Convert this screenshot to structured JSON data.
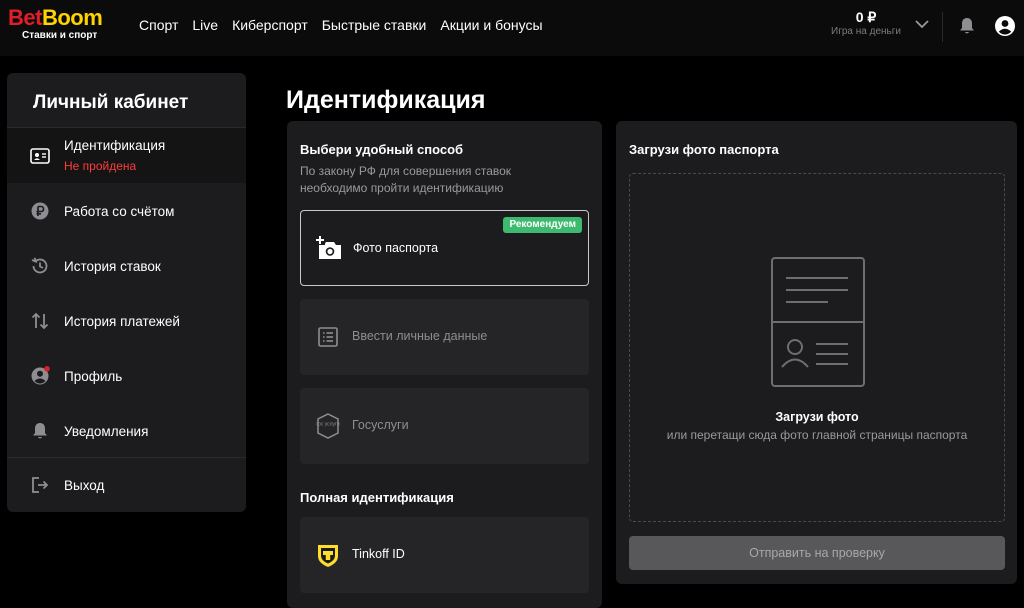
{
  "header": {
    "logo": {
      "part1": "Bet",
      "part2": "Boom",
      "tagline": "Ставки и спорт"
    },
    "nav": [
      "Спорт",
      "Live",
      "Киберспорт",
      "Быстрые ставки",
      "Акции и бонусы"
    ],
    "balance": {
      "amount": "0 ₽",
      "label": "Игра на деньги"
    },
    "icons": [
      "chevron-down-icon",
      "bell-icon",
      "user-icon"
    ]
  },
  "sidebar": {
    "title": "Личный кабинет",
    "items": [
      {
        "label": "Идентификация",
        "status": "Не пройдена",
        "icon": "id-card-icon"
      },
      {
        "label": "Работа со счётом",
        "icon": "ruble-icon"
      },
      {
        "label": "История ставок",
        "icon": "history-icon"
      },
      {
        "label": "История платежей",
        "icon": "transfer-arrows-icon"
      },
      {
        "label": "Профиль",
        "icon": "profile-icon"
      },
      {
        "label": "Уведомления",
        "icon": "bell-icon"
      },
      {
        "label": "Выход",
        "icon": "logout-icon"
      }
    ]
  },
  "main": {
    "title": "Идентификация",
    "left": {
      "heading": "Выбери удобный способ",
      "description": "По закону РФ для совершения ставок необходимо пройти идентификацию",
      "options": [
        {
          "label": "Фото паспорта",
          "badge": "Рекомендуем",
          "icon": "add-photo-icon"
        },
        {
          "label": "Ввести личные данные",
          "icon": "list-icon"
        },
        {
          "label": "Госуслуги",
          "icon": "gosuslugi-icon",
          "icon_text": "гос услуги"
        }
      ],
      "full_heading": "Полная идентификация",
      "full_options": [
        {
          "label": "Tinkoff ID",
          "icon": "tinkoff-icon"
        }
      ]
    },
    "right": {
      "title": "Загрузи фото паспорта",
      "upload_title": "Загрузи фото",
      "upload_text": "или перетащи сюда фото главной страницы паспорта",
      "submit": "Отправить на проверку"
    }
  },
  "colors": {
    "brand_red": "#e01e2a",
    "brand_yellow": "#ffd300",
    "error": "#ff3b3b",
    "badge_green": "#3dba6f",
    "card_bg": "#1c1c1e"
  }
}
